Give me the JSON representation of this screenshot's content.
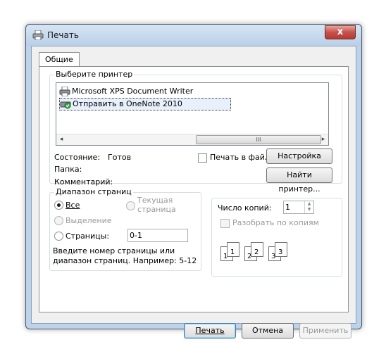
{
  "window": {
    "title": "Печать",
    "close_label": "x"
  },
  "tabs": [
    {
      "label": "Общие"
    }
  ],
  "printer_group": {
    "label": "Выберите принтер",
    "printers": [
      {
        "name": "Microsoft XPS Document Writer",
        "selected": false
      },
      {
        "name": "Отправить в OneNote 2010",
        "selected": true
      }
    ],
    "scrollbar": {
      "grip": "III"
    },
    "status_label": "Состояние:",
    "status_value": "Готов",
    "folder_label": "Папка:",
    "comment_label": "Комментарий:",
    "print_to_file_label": "Печать в файл",
    "print_to_file_checked": false,
    "settings_button": "Настройка",
    "find_printer_button": "Найти принтер..."
  },
  "range_group": {
    "label": "Диапазон страниц",
    "all_label": "Все",
    "current_label": "Текущая страница",
    "selection_label": "Выделение",
    "pages_label": "Страницы:",
    "pages_value": "0-1",
    "hint": "Введите номер страницы или диапазон страниц.  Например: 5-12"
  },
  "copies_group": {
    "copies_label": "Число копий:",
    "copies_value": "1",
    "collate_label": "Разобрать по копиям",
    "collate_checked": false,
    "collate_icons": [
      "1",
      "1",
      "2",
      "2",
      "3",
      "3"
    ]
  },
  "footer": {
    "print_button": "Печать",
    "cancel_button": "Отмена",
    "apply_button": "Применить"
  }
}
